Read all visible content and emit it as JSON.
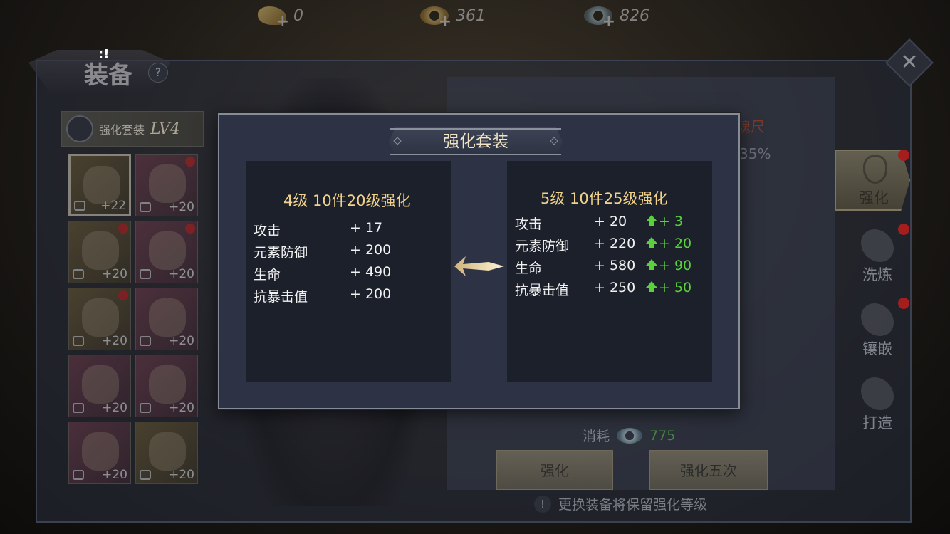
{
  "currencies": [
    {
      "icon": "gold-ingot-icon",
      "value": "0"
    },
    {
      "icon": "gold-ring-coin-icon",
      "value": "361"
    },
    {
      "icon": "silver-ring-coin-icon",
      "value": "826"
    }
  ],
  "header": {
    "title": "装备",
    "help": "?",
    "alert": ":!"
  },
  "suit_tag": {
    "label": "强化套装",
    "level": "LV4"
  },
  "equipment_slots": [
    {
      "level": "+22",
      "frame": "gold",
      "selected": true,
      "red_dot": false
    },
    {
      "level": "+20",
      "frame": "pink",
      "selected": false,
      "red_dot": true
    },
    {
      "level": "+20",
      "frame": "gold",
      "selected": false,
      "red_dot": true
    },
    {
      "level": "+20",
      "frame": "pink",
      "selected": false,
      "red_dot": true
    },
    {
      "level": "+20",
      "frame": "gold",
      "selected": false,
      "red_dot": true
    },
    {
      "level": "+20",
      "frame": "pink",
      "selected": false,
      "red_dot": false
    },
    {
      "level": "+20",
      "frame": "pink",
      "selected": false,
      "red_dot": false
    },
    {
      "level": "+20",
      "frame": "pink",
      "selected": false,
      "red_dot": false
    },
    {
      "level": "+20",
      "frame": "pink",
      "selected": false,
      "red_dot": false
    },
    {
      "level": "+20",
      "frame": "gold",
      "selected": false,
      "red_dot": false
    }
  ],
  "background_panel": {
    "item_name_partial": "魂尺",
    "percent_partial": "35%",
    "value_partial": "3",
    "consume_label": "消耗",
    "consume_amount": "775",
    "enhance_button": "强化",
    "enhance_five_button": "强化五次",
    "note_icon": "!",
    "note_text": "更换装备将保留强化等级"
  },
  "side_tabs": [
    {
      "label": "强化",
      "icon": "anchor-hammer-icon",
      "active": true
    },
    {
      "label": "洗炼",
      "icon": "demon-mask-icon",
      "active": false
    },
    {
      "label": "镶嵌",
      "icon": "spiked-gem-icon",
      "active": false
    },
    {
      "label": "打造",
      "icon": "anvil-hammer-icon",
      "active": false
    }
  ],
  "modal": {
    "title": "强化套装",
    "current": {
      "heading": "4级 10件20级强化",
      "stats": [
        {
          "name": "攻击",
          "value": "+ 17"
        },
        {
          "name": "元素防御",
          "value": "+ 200"
        },
        {
          "name": "生命",
          "value": "+ 490"
        },
        {
          "name": "抗暴击值",
          "value": "+ 200"
        }
      ]
    },
    "next": {
      "heading": "5级 10件25级强化",
      "stats": [
        {
          "name": "攻击",
          "value": "+ 20",
          "increase": "+ 3"
        },
        {
          "name": "元素防御",
          "value": "+ 220",
          "increase": "+ 20"
        },
        {
          "name": "生命",
          "value": "+ 580",
          "increase": "+ 90"
        },
        {
          "name": "抗暴击值",
          "value": "+ 250",
          "increase": "+ 50"
        }
      ]
    }
  },
  "colors": {
    "modal_bg": "#2d3345",
    "box_bg": "#1c202b",
    "heading_gold": "#f1d28a",
    "increase_green": "#58d13a",
    "title_cream": "#f0e3c6"
  }
}
